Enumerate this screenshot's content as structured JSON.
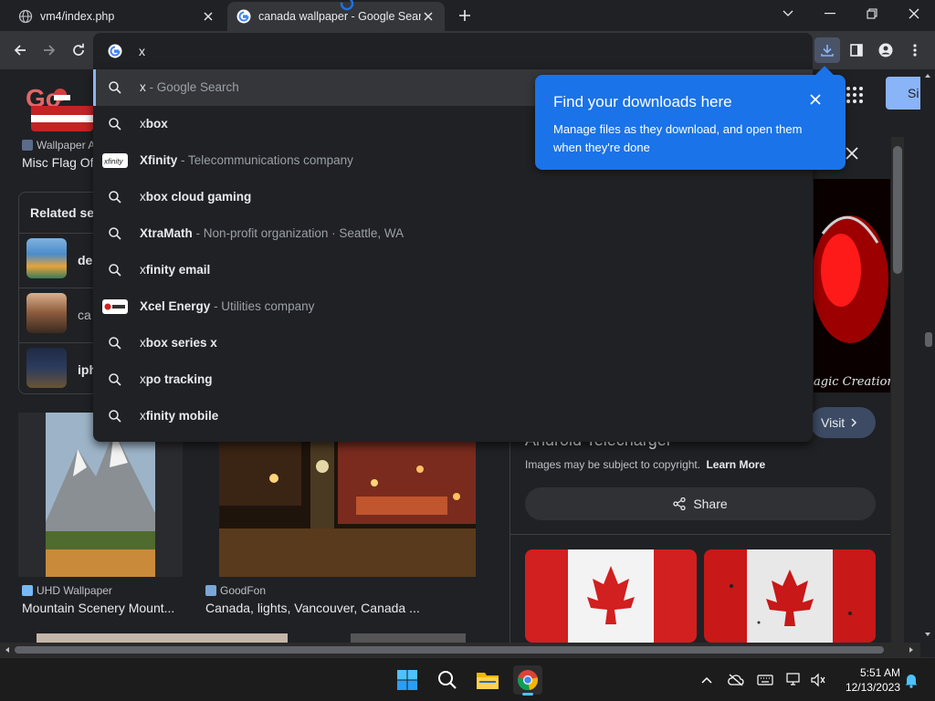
{
  "tabs": [
    {
      "title": "vm4/index.php",
      "active": false
    },
    {
      "title": "canada wallpaper - Google Search",
      "active": true
    }
  ],
  "omnibox": {
    "value": "x"
  },
  "suggestions": [
    {
      "match": "x",
      "rest": "",
      "desc": " - Google Search",
      "icon": "search-icon",
      "selected": true
    },
    {
      "match": "x",
      "rest": "box",
      "desc": "",
      "icon": "search-icon"
    },
    {
      "match": "X",
      "rest": "finity",
      "desc": " - Telecommunications company",
      "icon": "xfinity-logo-icon"
    },
    {
      "match": "x",
      "rest": "box cloud gaming",
      "desc": "",
      "icon": "search-icon"
    },
    {
      "match": "X",
      "rest": "traMath",
      "desc": " - Non-profit organization · Seattle, WA",
      "icon": "search-icon"
    },
    {
      "match": "x",
      "rest": "finity email",
      "desc": "",
      "icon": "search-icon"
    },
    {
      "match": "X",
      "rest": "cel Energy",
      "desc": " - Utilities company",
      "icon": "xcel-logo-icon"
    },
    {
      "match": "x",
      "rest": "box series x",
      "desc": "",
      "icon": "search-icon"
    },
    {
      "match": "x",
      "rest": "po tracking",
      "desc": "",
      "icon": "search-icon"
    },
    {
      "match": "x",
      "rest": "finity mobile",
      "desc": "",
      "icon": "search-icon"
    }
  ],
  "download_bubble": {
    "title": "Find your downloads here",
    "body": "Manage files as they download, and open them when they're done"
  },
  "page": {
    "left_source": "Wallpaper A",
    "left_caption": "Misc Flag Of",
    "related_title": "Related se",
    "related_items": [
      "de",
      "ca",
      "iph"
    ],
    "image1_source": "UHD Wallpaper",
    "image1_caption": "Mountain Scenery Mount...",
    "image2_source": "GoodFon",
    "image2_caption": "Canada, lights, Vancouver, Canada ...",
    "preview_watermark": "agic Creations",
    "visit_label": "Visit",
    "preview_title": "Android Telecharger",
    "copyright_text": "Images may be subject to copyright.",
    "learn_more": "Learn More",
    "share_label": "Share",
    "signin_label": "Si"
  },
  "taskbar": {
    "time": "5:51 AM",
    "date": "12/13/2023"
  },
  "colors": {
    "accent_blue": "#1a73e8",
    "link_blue": "#8ab4f8",
    "background": "#202124",
    "toolbar": "#35363a"
  }
}
